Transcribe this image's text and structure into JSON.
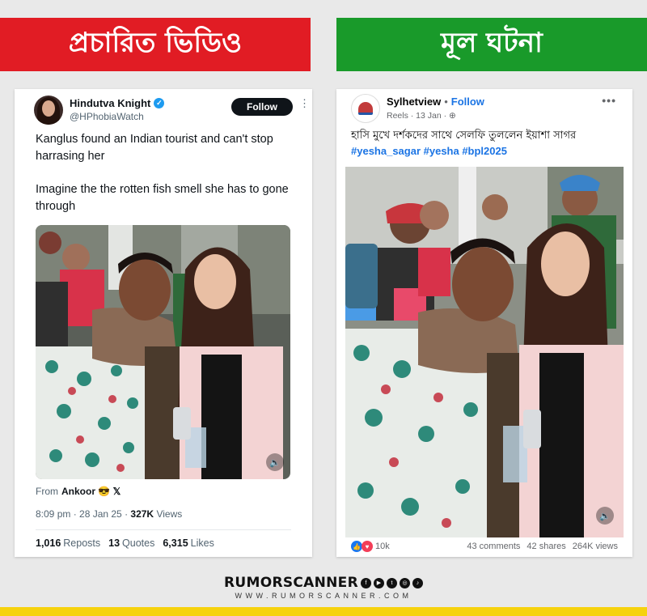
{
  "banners": {
    "left": "প্রচারিত ভিডিও",
    "right": "মূল ঘটনা"
  },
  "tweet": {
    "name": "Hindutva Knight",
    "handle": "@HPhobiaWatch",
    "follow_label": "Follow",
    "text_1": "Kanglus found an Indian tourist and can't stop harrasing her",
    "text_2": "Imagine the the rotten fish smell she has to gone through",
    "credit_prefix": "From",
    "credit_name": "Ankoor 😎 𝕏",
    "time": "8:09 pm · 28 Jan 25 · ",
    "views_count": "327K",
    "views_label": "Views",
    "reposts_count": "1,016",
    "reposts_label": "Reposts",
    "quotes_count": "13",
    "quotes_label": "Quotes",
    "likes_count": "6,315",
    "likes_label": "Likes"
  },
  "facebook_post": {
    "page_name": "Sylhetview",
    "follow_label": "Follow",
    "sub": "Reels · 13 Jan · ⊕",
    "caption": "হাসি মুখে দর্শকদের সাথে সেলফি তুললেন ইয়াশা সাগর",
    "hashtags": "#yesha_sagar #yesha #bpl2025",
    "reactions": "10k",
    "comments": "43 comments",
    "shares": "42 shares",
    "views": "264K views"
  },
  "footer": {
    "brand": "RUMORSCANNER",
    "url": "WWW.RUMORSCANNER.COM"
  },
  "icons": [
    "verified-badge-icon",
    "more-icon",
    "volume-icon",
    "globe-icon",
    "like-reaction-icon",
    "love-reaction-icon",
    "facebook-icon",
    "youtube-icon",
    "twitter-icon",
    "instagram-icon",
    "tiktok-icon"
  ],
  "colors": {
    "left_banner": "#e11c24",
    "right_banner": "#199a2a",
    "twitter_blue": "#1d9bf0",
    "facebook_blue": "#1b74e4",
    "footer_bar": "#f6d20e"
  }
}
